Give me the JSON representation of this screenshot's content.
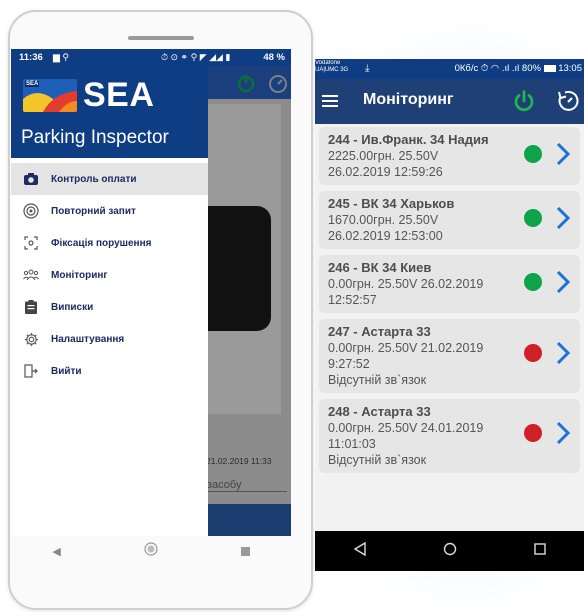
{
  "left_phone": {
    "status": {
      "time": "11:36",
      "right": "48 %"
    },
    "logo": {
      "tag": "SEA",
      "text": "SEA"
    },
    "app_title": "Parking Inspector",
    "menu": [
      {
        "label": "Контроль оплати",
        "icon": "camera-icon",
        "active": true
      },
      {
        "label": "Повторний запит",
        "icon": "target-icon",
        "active": false
      },
      {
        "label": "Фіксація порушення",
        "icon": "focus-icon",
        "active": false
      },
      {
        "label": "Моніторинг",
        "icon": "group-icon",
        "active": false
      },
      {
        "label": "Виписки",
        "icon": "clipboard-icon",
        "active": false
      },
      {
        "label": "Налаштування",
        "icon": "gear-icon",
        "active": false
      },
      {
        "label": "Вийти",
        "icon": "exit-icon",
        "active": false
      }
    ],
    "background": {
      "date": "21.02.2019 11:33",
      "field": "засобу"
    }
  },
  "right_phone": {
    "status": {
      "operator": "Vodafone UA|UMC 3G",
      "speed": "0Кб/с",
      "battery": "80%",
      "time": "13:05"
    },
    "toolbar_title": "Моніторинг",
    "items": [
      {
        "title": "244 - Ив.Франк. 34 Надия",
        "lines": [
          "2225.00грн. 25.50V",
          "26.02.2019 12:59:26"
        ],
        "status": "green"
      },
      {
        "title": "245 - ВК 34 Харьков",
        "lines": [
          "1670.00грн. 25.50V",
          "26.02.2019 12:53:00"
        ],
        "status": "green"
      },
      {
        "title": "246 - ВК 34 Киев",
        "lines": [
          "0.00грн. 25.50V 26.02.2019",
          "12:52:57"
        ],
        "status": "green"
      },
      {
        "title": "247 - Астарта 33",
        "lines": [
          "0.00грн. 25.50V 21.02.2019",
          "9:27:52",
          "Відсутній зв`язок"
        ],
        "status": "red"
      },
      {
        "title": "248 - Астарта 33",
        "lines": [
          "0.00грн. 25.50V 24.01.2019",
          "11:01:03",
          "Відсутній зв`язок"
        ],
        "status": "red"
      }
    ]
  },
  "colors": {
    "primary": "#1f3f77",
    "green": "#0ea54a",
    "red": "#d0212a",
    "chevron": "#1a73d9"
  }
}
